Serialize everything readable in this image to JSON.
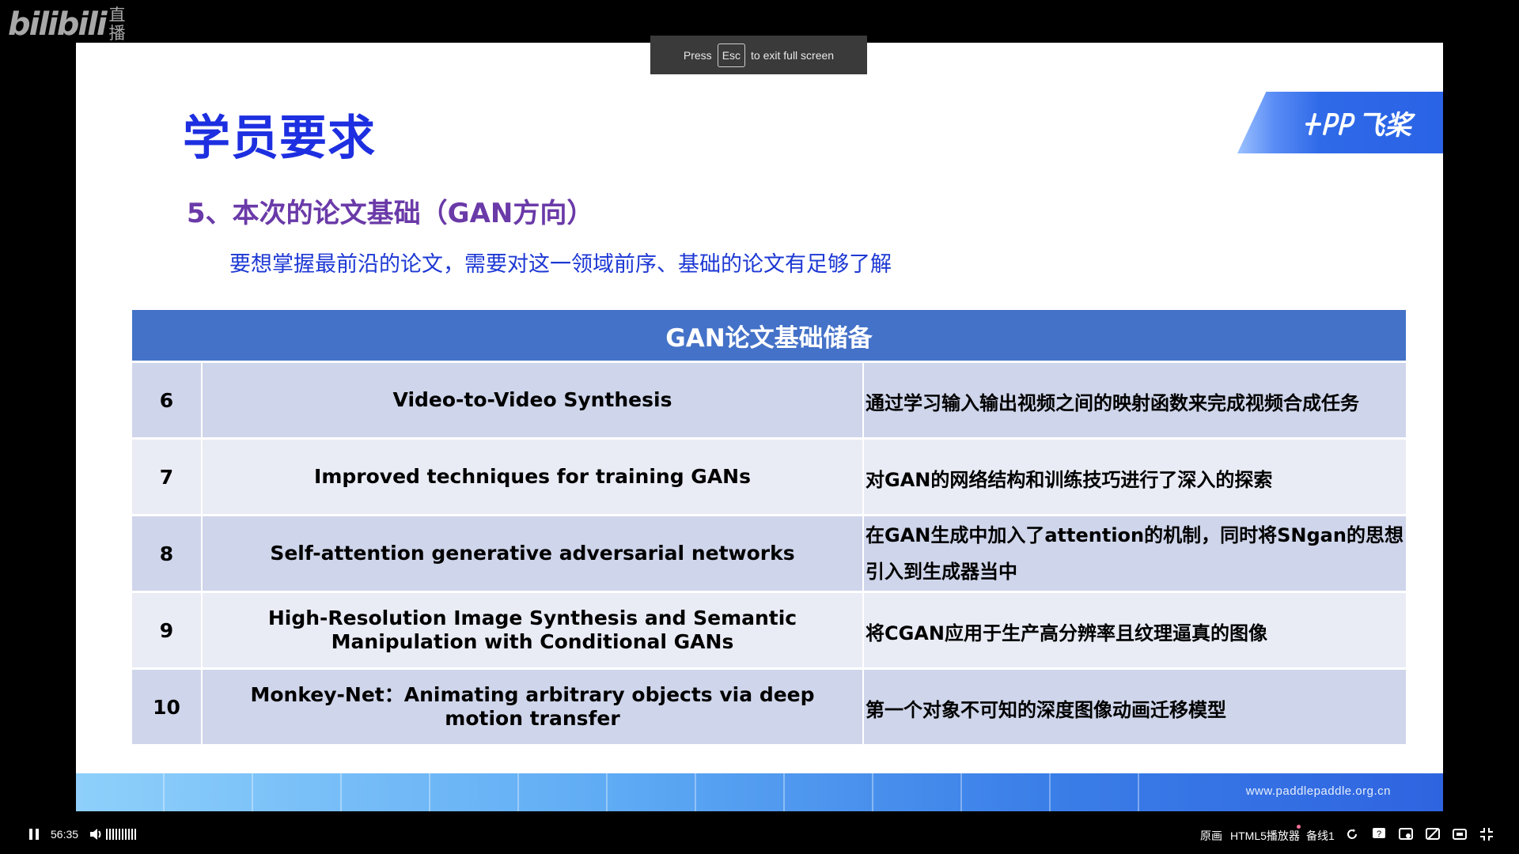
{
  "logo": {
    "main": "bilibili",
    "sub_top": "直",
    "sub_bottom": "播"
  },
  "fullscreen_tip": {
    "press": "Press",
    "key": "Esc",
    "rest": "to exit full screen"
  },
  "slide": {
    "title": "学员要求",
    "brand": "飞桨",
    "section_heading": "5、本次的论文基础（GAN方向）",
    "section_sub": "要想掌握最前沿的论文，需要对这一领域前序、基础的论文有足够了解",
    "table": {
      "header": "GAN论文基础储备",
      "rows": [
        {
          "num": "6",
          "title": "Video-to-Video Synthesis",
          "desc": "通过学习输入输出视频之间的映射函数来完成视频合成任务"
        },
        {
          "num": "7",
          "title": "Improved techniques for training GANs",
          "desc": "对GAN的网络结构和训练技巧进行了深入的探索"
        },
        {
          "num": "8",
          "title": "Self-attention generative adversarial networks",
          "desc": "在GAN生成中加入了attention的机制，同时将SNgan的思想引入到生成器当中"
        },
        {
          "num": "9",
          "title": "High-Resolution Image Synthesis and Semantic Manipulation with Conditional GANs",
          "desc": "将CGAN应用于生产高分辨率且纹理逼真的图像"
        },
        {
          "num": "10",
          "title": "Monkey-Net：Animating arbitrary objects via deep motion transfer",
          "desc": "第一个对象不可知的深度图像动画迁移模型"
        }
      ]
    },
    "footer_url": "www.paddlepaddle.org.cn"
  },
  "player": {
    "time": "56:35",
    "quality": "原画",
    "player_type": "HTML5播放器",
    "line": "备线1",
    "colors": {
      "accent_dot": "#fb7299"
    }
  }
}
